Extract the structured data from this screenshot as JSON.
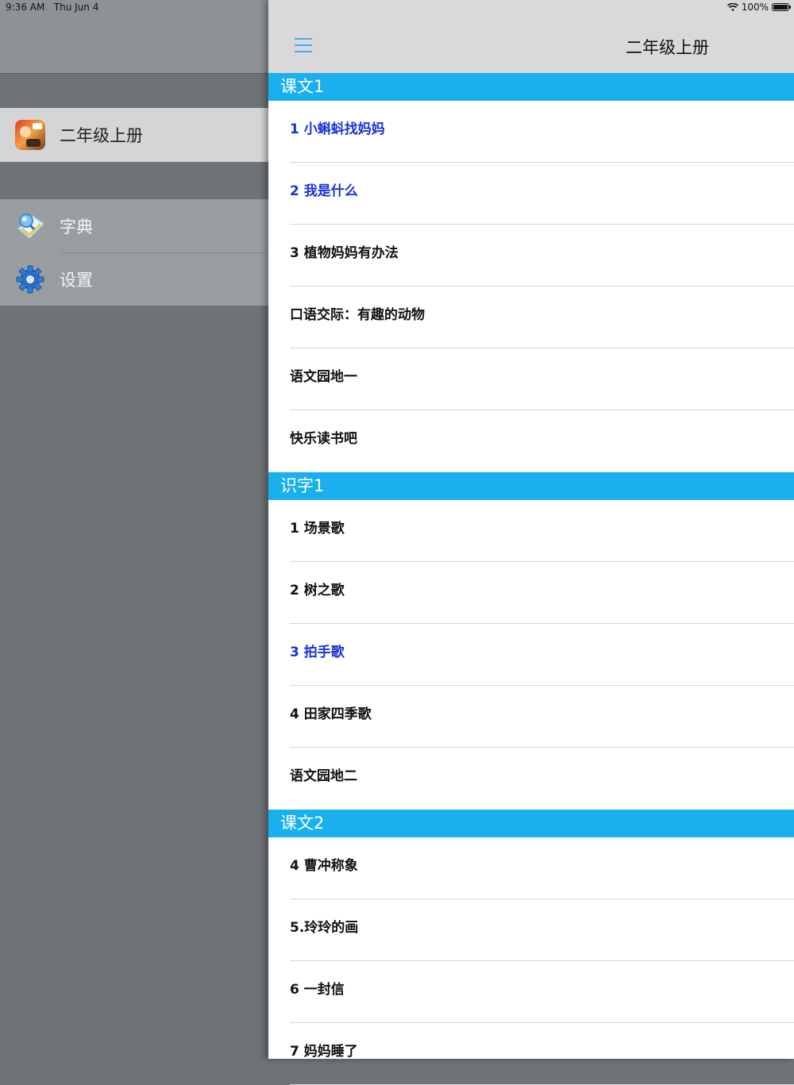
{
  "status_bar": {
    "time": "9:36 AM",
    "date": "Thu Jun 4",
    "battery": "100%",
    "battery_level": 1.0
  },
  "sidebar": {
    "book_item": {
      "label": "二年级上册",
      "icon": "book-cover-icon"
    },
    "menu_items": [
      {
        "label": "字典",
        "icon": "dictionary-icon"
      },
      {
        "label": "设置",
        "icon": "gear-icon"
      }
    ]
  },
  "nav": {
    "title": "二年级上册",
    "menu_icon": "hamburger-menu-icon"
  },
  "colors": {
    "section_header": "#1ab0ee",
    "highlight_text": "#1a32d6",
    "accent": "#48a9e8"
  },
  "sections": [
    {
      "title": "课文1",
      "items": [
        {
          "label": "1 小蝌蚪找妈妈",
          "highlighted": true
        },
        {
          "label": "2 我是什么",
          "highlighted": true
        },
        {
          "label": "3 植物妈妈有办法",
          "highlighted": false
        },
        {
          "label": "口语交际：有趣的动物",
          "highlighted": false
        },
        {
          "label": "语文园地一",
          "highlighted": false
        },
        {
          "label": "快乐读书吧",
          "highlighted": false
        }
      ]
    },
    {
      "title": "识字1",
      "items": [
        {
          "label": "1 场景歌",
          "highlighted": false
        },
        {
          "label": "2 树之歌",
          "highlighted": false
        },
        {
          "label": "3 拍手歌",
          "highlighted": true
        },
        {
          "label": "4 田家四季歌",
          "highlighted": false
        },
        {
          "label": "语文园地二",
          "highlighted": false
        }
      ]
    },
    {
      "title": "课文2",
      "items": [
        {
          "label": "4 曹冲称象",
          "highlighted": false
        },
        {
          "label": "5.玲玲的画",
          "highlighted": false
        },
        {
          "label": "6 一封信",
          "highlighted": false
        },
        {
          "label": "7 妈妈睡了",
          "highlighted": false
        }
      ]
    }
  ]
}
